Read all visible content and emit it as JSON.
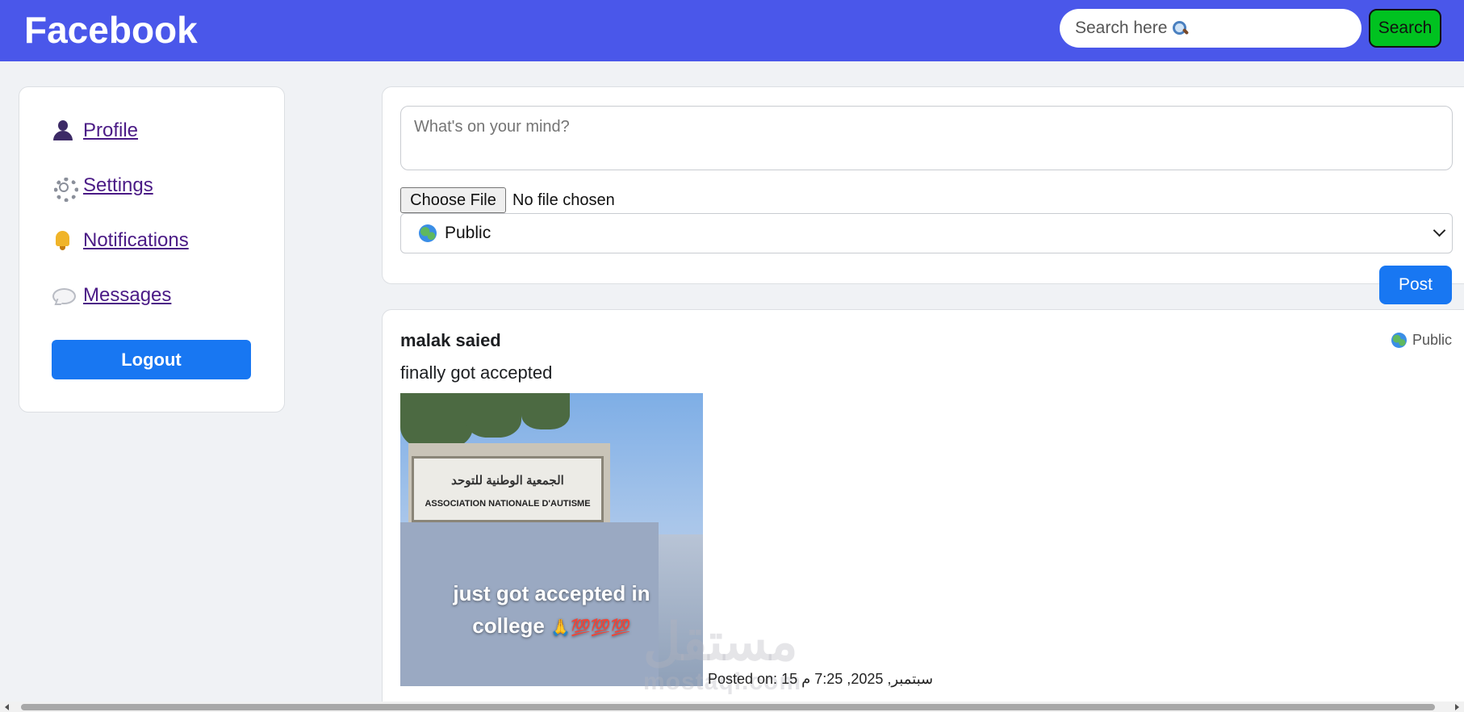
{
  "header": {
    "brand": "Facebook",
    "search_placeholder": "Search here",
    "search_button": "Search"
  },
  "sidebar": {
    "items": [
      {
        "label": "Profile",
        "icon": "user-icon"
      },
      {
        "label": "Settings",
        "icon": "gear-icon"
      },
      {
        "label": "Notifications",
        "icon": "bell-icon"
      },
      {
        "label": "Messages",
        "icon": "speech-bubble-icon"
      }
    ],
    "logout": "Logout"
  },
  "composer": {
    "placeholder": "What's on your mind?",
    "choose_file": "Choose File",
    "file_status": "No file chosen",
    "privacy": "Public",
    "post_button": "Post"
  },
  "post": {
    "author": "malak saied",
    "visibility": "Public",
    "text": "finally got accepted",
    "image": {
      "sign_arabic": "الجمعية الوطنية للتوحد",
      "sign_english": "ASSOCIATION NATIONALE D'AUTISME",
      "caption_line1": "just got accepted in",
      "caption_line2": "college",
      "caption_emoji": "🙏💯💯💯"
    },
    "posted_on": "Posted on: 15 سبتمبر, 2025, 7:25 م"
  },
  "watermark": {
    "arabic": "مستقل",
    "latin": "mostaql.com"
  },
  "colors": {
    "header_bg": "#4a57ea",
    "primary_button": "#1877f2",
    "search_button": "#00c220",
    "link": "#4b1b86"
  }
}
